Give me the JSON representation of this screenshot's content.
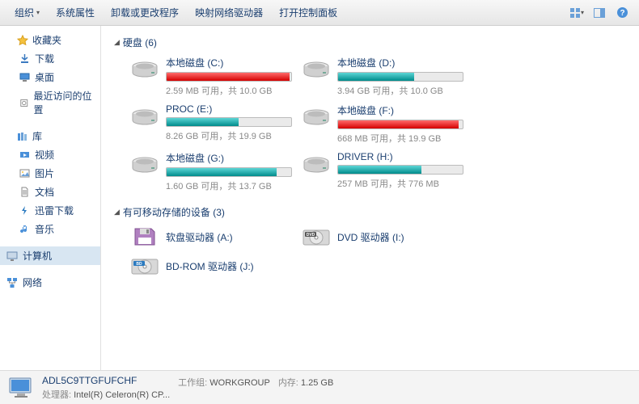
{
  "toolbar": {
    "organize": "组织",
    "system_props": "系统属性",
    "uninstall": "卸载或更改程序",
    "map_drive": "映射网络驱动器",
    "control_panel": "打开控制面板"
  },
  "sidebar": {
    "favorites": {
      "label": "收藏夹",
      "items": [
        "下载",
        "桌面",
        "最近访问的位置"
      ]
    },
    "libraries": {
      "label": "库",
      "items": [
        "视频",
        "图片",
        "文档",
        "迅雷下载",
        "音乐"
      ]
    },
    "computer": {
      "label": "计算机"
    },
    "network": {
      "label": "网络"
    }
  },
  "sections": {
    "hdd": {
      "label": "硬盘 (6)"
    },
    "removable": {
      "label": "有可移动存储的设备 (3)"
    }
  },
  "chart_data": {
    "type": "bar",
    "title": "硬盘使用情况",
    "series": [
      {
        "name": "本地磁盘 (C:)",
        "free": 2.59,
        "total": 10.0,
        "unit_free": "MB",
        "unit_total": "GB",
        "color": "red",
        "fill": 99
      },
      {
        "name": "本地磁盘 (D:)",
        "free": 3.94,
        "total": 10.0,
        "unit_free": "GB",
        "unit_total": "GB",
        "color": "teal",
        "fill": 61
      },
      {
        "name": "PROC (E:)",
        "free": 8.26,
        "total": 19.9,
        "unit_free": "GB",
        "unit_total": "GB",
        "color": "teal",
        "fill": 58
      },
      {
        "name": "本地磁盘 (F:)",
        "free": 668,
        "total": 19.9,
        "unit_free": "MB",
        "unit_total": "GB",
        "color": "red",
        "fill": 97
      },
      {
        "name": "本地磁盘 (G:)",
        "free": 1.6,
        "total": 13.7,
        "unit_free": "GB",
        "unit_total": "GB",
        "color": "teal",
        "fill": 88
      },
      {
        "name": "DRIVER (H:)",
        "free": 257,
        "total": 776,
        "unit_free": "MB",
        "unit_total": "MB",
        "color": "teal",
        "fill": 67
      }
    ]
  },
  "drives": [
    {
      "name": "本地磁盘 (C:)",
      "stats": "2.59 MB 可用，共 10.0 GB",
      "color": "red",
      "fill": 99
    },
    {
      "name": "本地磁盘 (D:)",
      "stats": "3.94 GB 可用，共 10.0 GB",
      "color": "teal",
      "fill": 61
    },
    {
      "name": "PROC (E:)",
      "stats": "8.26 GB 可用，共 19.9 GB",
      "color": "teal",
      "fill": 58
    },
    {
      "name": "本地磁盘 (F:)",
      "stats": "668 MB 可用，共 19.9 GB",
      "color": "red",
      "fill": 97
    },
    {
      "name": "本地磁盘 (G:)",
      "stats": "1.60 GB 可用，共 13.7 GB",
      "color": "teal",
      "fill": 88
    },
    {
      "name": "DRIVER (H:)",
      "stats": "257 MB 可用，共 776 MB",
      "color": "teal",
      "fill": 67
    }
  ],
  "devices": [
    {
      "name": "软盘驱动器 (A:)",
      "icon": "floppy"
    },
    {
      "name": "DVD 驱动器 (I:)",
      "icon": "dvd"
    },
    {
      "name": "BD-ROM 驱动器 (J:)",
      "icon": "bd"
    }
  ],
  "status": {
    "name": "ADL5C9TTGFUFCHF",
    "workgroup_label": "工作组:",
    "workgroup": "WORKGROUP",
    "cpu_label": "处理器:",
    "cpu": "Intel(R) Celeron(R) CP...",
    "mem_label": "内存:",
    "mem": "1.25 GB"
  }
}
